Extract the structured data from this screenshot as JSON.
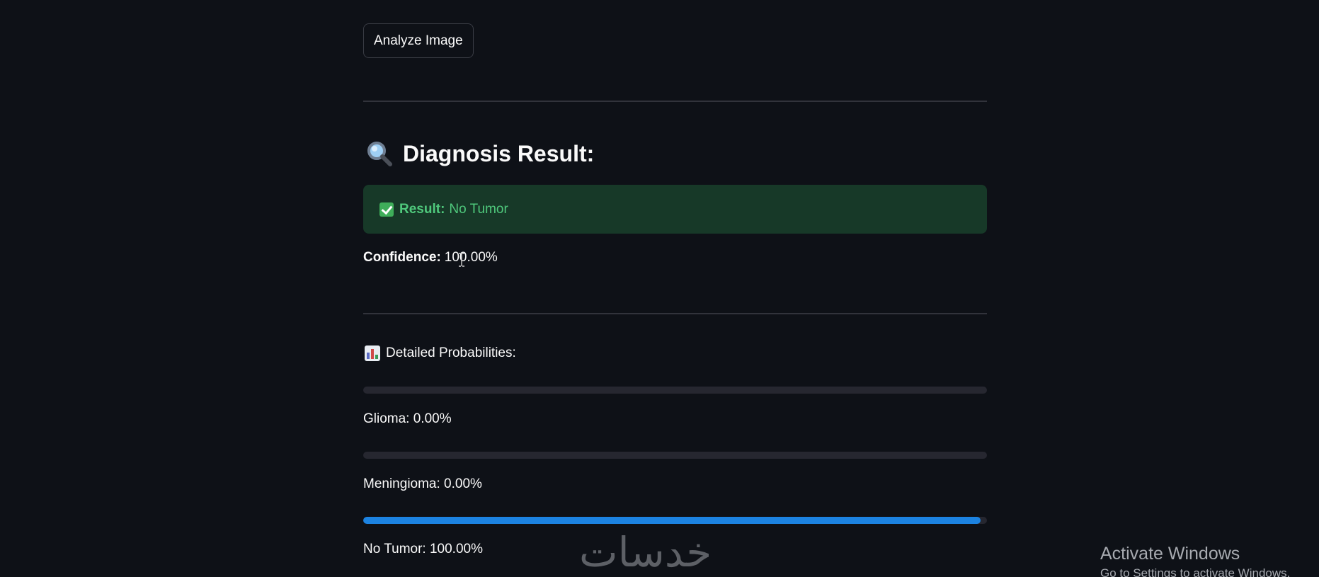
{
  "actions": {
    "analyze_label": "Analyze Image"
  },
  "result": {
    "heading": "Diagnosis Result:",
    "alert_label": "Result:",
    "alert_value": "No Tumor",
    "confidence_label": "Confidence:",
    "confidence_value": "100.00%",
    "alert_color": "#173928",
    "alert_text_color": "#4fc97c"
  },
  "probabilities": {
    "heading": "Detailed Probabilities:",
    "accent_color": "#1c83e1",
    "items": [
      {
        "label": "Glioma: 0.00%",
        "fraction": 0.0
      },
      {
        "label": "Meningioma: 0.00%",
        "fraction": 0.0
      },
      {
        "label": "No Tumor: 100.00%",
        "fraction": 1.0
      }
    ]
  },
  "icons": {
    "heading_icon": "magnifying-glass-icon",
    "alert_icon": "check-mark-icon",
    "probabilities_icon": "bar-chart-icon"
  },
  "overlay": {
    "watermark_text": "خدسات",
    "activate_title": "Activate Windows",
    "activate_subtitle": "Go to Settings to activate Windows."
  }
}
